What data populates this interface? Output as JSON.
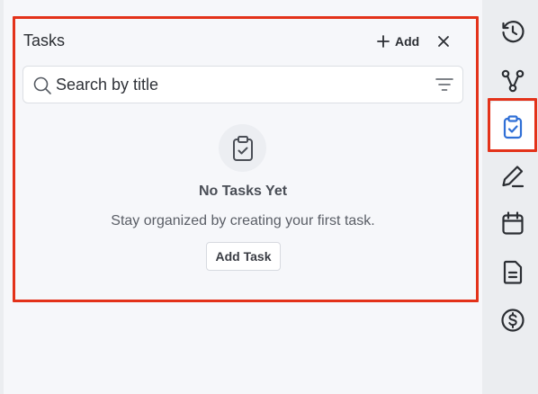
{
  "panel": {
    "title": "Tasks",
    "add_label": "Add",
    "search_placeholder": "Search by title"
  },
  "empty_state": {
    "title": "No Tasks Yet",
    "subtitle": "Stay organized by creating your first task.",
    "button_label": "Add Task"
  },
  "rail": {
    "items": [
      {
        "icon": "history-icon"
      },
      {
        "icon": "workflow-icon"
      },
      {
        "icon": "tasks-icon",
        "active": true
      },
      {
        "icon": "pen-icon"
      },
      {
        "icon": "calendar-icon"
      },
      {
        "icon": "document-icon"
      },
      {
        "icon": "dollar-icon"
      }
    ]
  },
  "colors": {
    "highlight": "#e3321a",
    "active_icon": "#2f6fd6",
    "icon": "#2b2e33"
  }
}
